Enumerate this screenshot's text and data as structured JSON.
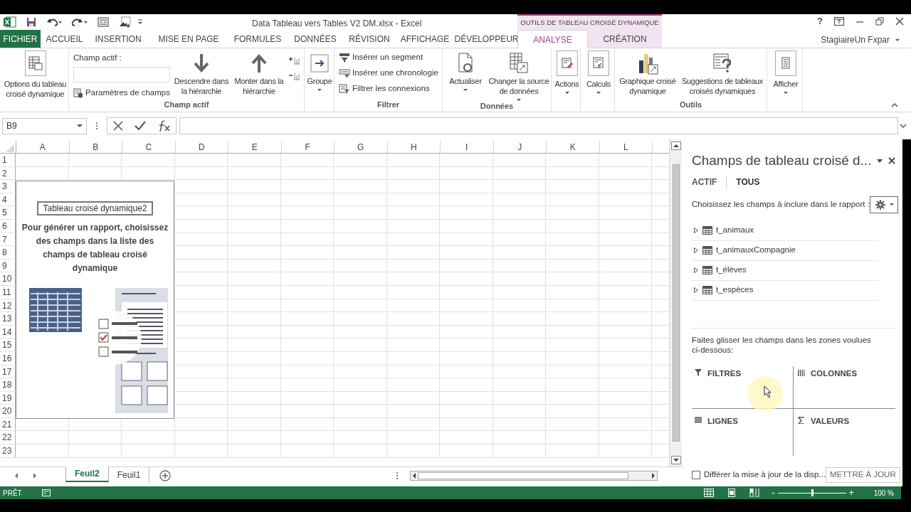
{
  "title_bar": {
    "title": "Data Tableau vers Tables V2 DM.xlsx - Excel",
    "contextual_group": "OUTILS DE TABLEAU CROISÉ DYNAMIQUE",
    "help": "?",
    "user": "StagiaireUn Fxpar"
  },
  "tabs": [
    {
      "label": "FICHIER",
      "kind": "file",
      "selected": false
    },
    {
      "label": "ACCUEIL",
      "kind": "normal",
      "selected": false
    },
    {
      "label": "INSERTION",
      "kind": "normal",
      "selected": false
    },
    {
      "label": "MISE EN PAGE",
      "kind": "normal",
      "selected": false
    },
    {
      "label": "FORMULES",
      "kind": "normal",
      "selected": false
    },
    {
      "label": "DONNÉES",
      "kind": "normal",
      "selected": false
    },
    {
      "label": "RÉVISION",
      "kind": "normal",
      "selected": false
    },
    {
      "label": "AFFICHAGE",
      "kind": "normal",
      "selected": false
    },
    {
      "label": "DÉVELOPPEUR",
      "kind": "normal",
      "selected": false
    },
    {
      "label": "ANALYSE",
      "kind": "contextual",
      "selected": true
    },
    {
      "label": "CRÉATION",
      "kind": "contextual",
      "selected": false
    }
  ],
  "ribbon": {
    "pivot_options": "Options du tableau croisé dynamique",
    "active_field": {
      "caption": "Champ actif :",
      "field_settings": "Paramètres de champs",
      "drill_down": "Descendre dans la hiérarchie",
      "drill_up": "Monter dans la hiérarchie",
      "group_label": "Champ actif"
    },
    "group": "Groupe",
    "filter": {
      "items": [
        "Insérer un segment",
        "Insérer une chronologie",
        "Filtrer les connexions"
      ],
      "group_label": "Filtrer"
    },
    "data": {
      "refresh": "Actualiser",
      "change_source": "Changer la source de données",
      "group_label": "Données"
    },
    "actions": "Actions",
    "calculations": "Calculs",
    "tools": {
      "pivot_chart": "Graphique croisé dynamique",
      "recommended": "Suggestions de tableaux croisés dynamiques",
      "group_label": "Outils"
    },
    "show": "Afficher"
  },
  "formula_bar": {
    "name_box": "B9"
  },
  "sheet": {
    "columns": [
      "A",
      "B",
      "C",
      "D",
      "E",
      "F",
      "G",
      "H",
      "I",
      "J",
      "K",
      "L"
    ],
    "rows": [
      "1",
      "2",
      "3",
      "4",
      "5",
      "6",
      "7",
      "8",
      "9",
      "10",
      "11",
      "12",
      "13",
      "14",
      "15",
      "16",
      "17",
      "18",
      "19",
      "20",
      "21",
      "22",
      "23"
    ],
    "pivot_placeholder": {
      "name": "Tableau croisé dynamique2",
      "message": "Pour générer un rapport, choisissez des champs dans la liste des champs de tableau croisé dynamique"
    }
  },
  "sheet_tabs": [
    {
      "label": "Feuil2",
      "selected": true
    },
    {
      "label": "Feuil1",
      "selected": false
    }
  ],
  "field_pane": {
    "title": "Champs de tableau croisé d...",
    "views": [
      {
        "label": "ACTIF",
        "selected": false
      },
      {
        "label": "TOUS",
        "selected": true
      }
    ],
    "prompt": "Choisissez les champs à inclure dans le rapport :",
    "fields": [
      {
        "label": "t_animaux",
        "expanded": false
      },
      {
        "label": "t_animauxCompagnie",
        "expanded": false
      },
      {
        "label": "t_élèves",
        "expanded": false
      },
      {
        "label": "t_espèces",
        "expanded": false
      }
    ],
    "drag_hint": "Faites glisser les champs dans les zones voulues ci-dessous:",
    "areas": [
      {
        "kind": "filters",
        "label": "FILTRES"
      },
      {
        "kind": "columns",
        "label": "COLONNES"
      },
      {
        "kind": "rows",
        "label": "LIGNES"
      },
      {
        "kind": "values",
        "label": "VALEURS"
      }
    ],
    "defer": {
      "label": "Différer la mise à jour de la disp...",
      "checked": false
    },
    "update_button": "METTRE À JOUR"
  },
  "status_bar": {
    "status": "PRÊT",
    "zoom_out": "-",
    "zoom_in": "+",
    "zoom": "100 %"
  }
}
